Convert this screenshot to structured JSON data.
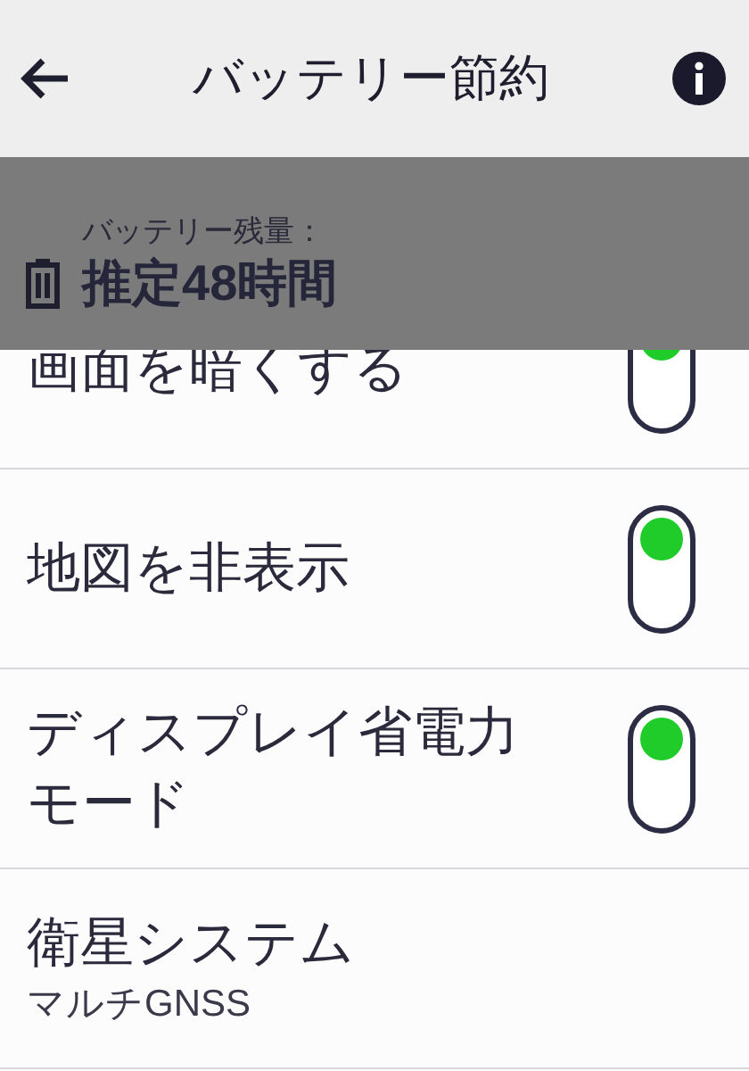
{
  "header": {
    "title": "バッテリー節約"
  },
  "battery_banner": {
    "label": "バッテリー残量：",
    "value": "推定48時間"
  },
  "settings": [
    {
      "kind": "toggle",
      "label": "画面を暗くする",
      "on": true
    },
    {
      "kind": "toggle",
      "label": "地図を非表示",
      "on": true
    },
    {
      "kind": "toggle",
      "label": "ディスプレイ省電力モード",
      "on": true
    },
    {
      "kind": "value",
      "label": "衛星システム",
      "value": "マルチGNSS"
    }
  ]
}
